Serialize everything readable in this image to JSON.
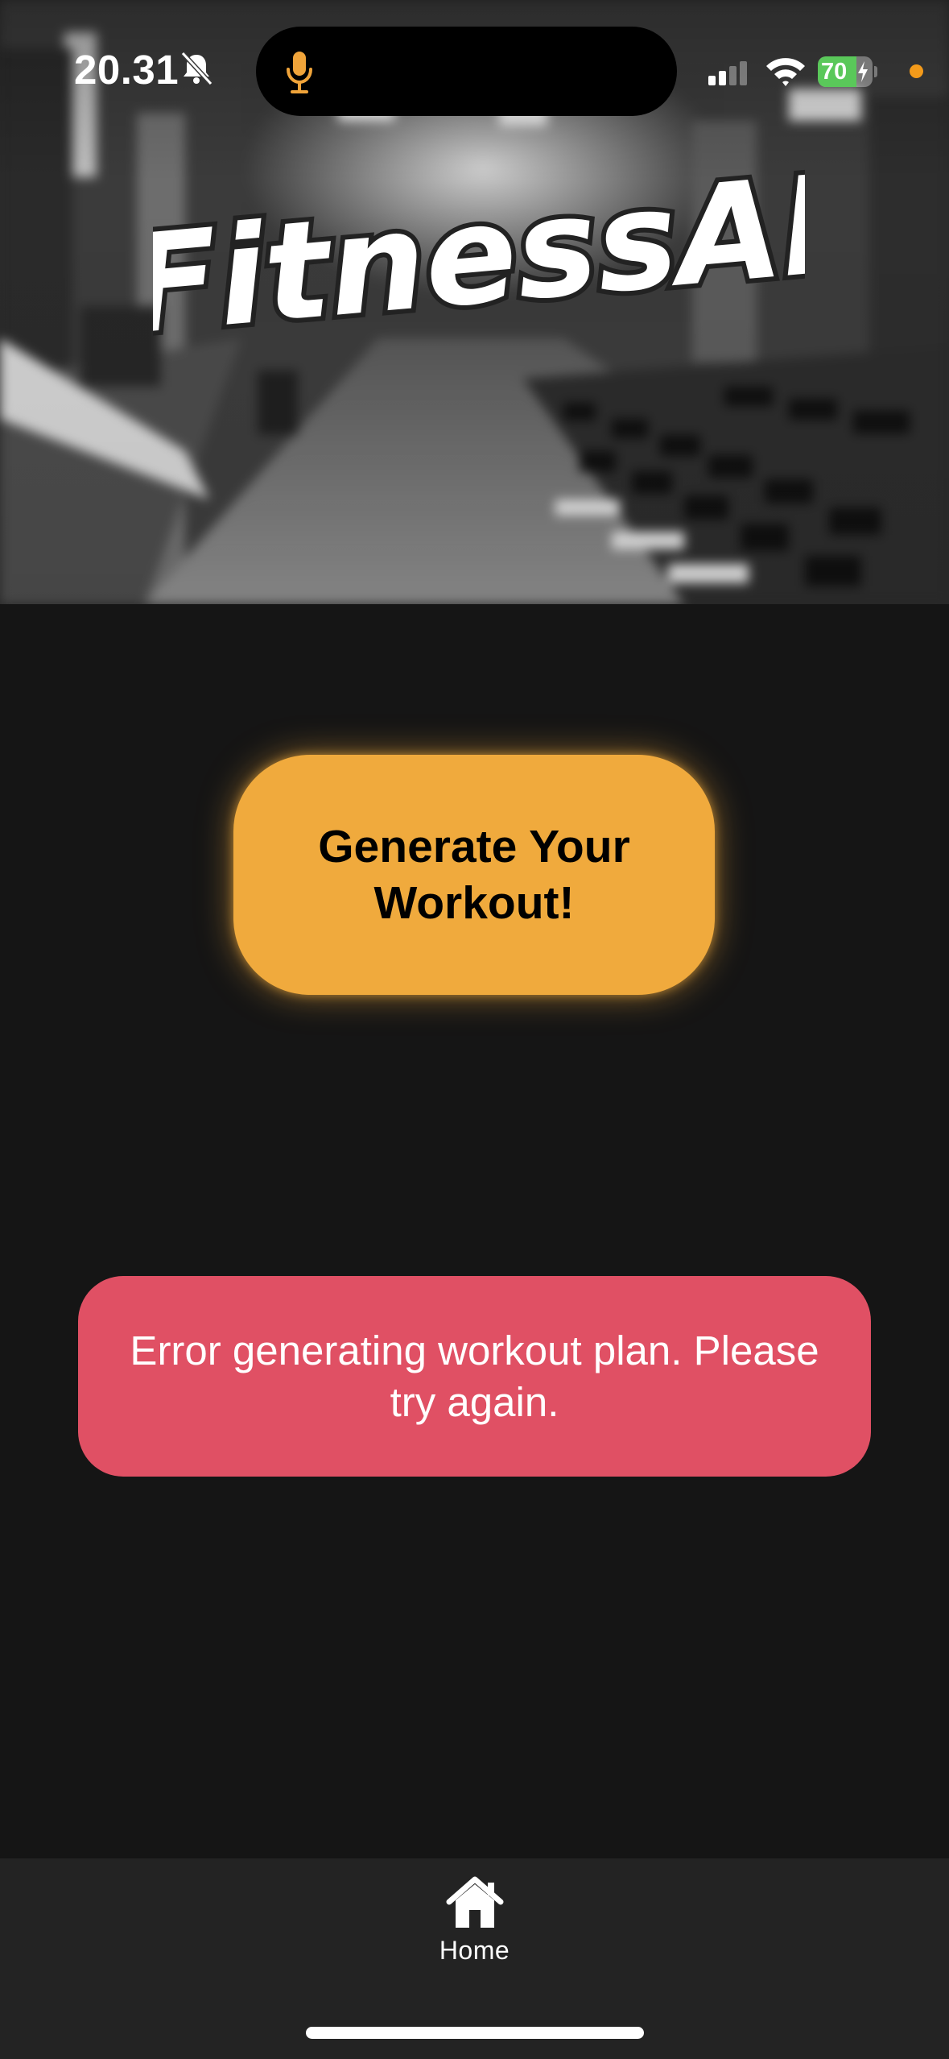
{
  "status_bar": {
    "time": "20.31",
    "battery_level": "70",
    "battery_fraction": 0.7,
    "icons": [
      "bell-slash-icon",
      "microphone-icon",
      "cellular-signal-icon",
      "wifi-icon",
      "battery-charging-icon",
      "privacy-indicator-dot"
    ]
  },
  "hero": {
    "logo_text": "FitnessAI"
  },
  "main": {
    "generate_button_label": "Generate Your Workout!",
    "error_message": "Error generating workout plan. Please try again."
  },
  "tab_bar": {
    "items": [
      {
        "label": "Home",
        "icon": "home-icon"
      }
    ]
  },
  "colors": {
    "background": "#151515",
    "accent": "#f0aa3d",
    "error": "#e05064",
    "tab_bar": "#232323",
    "battery_green": "#5ac85a",
    "mic_orange": "#f0a43a"
  }
}
